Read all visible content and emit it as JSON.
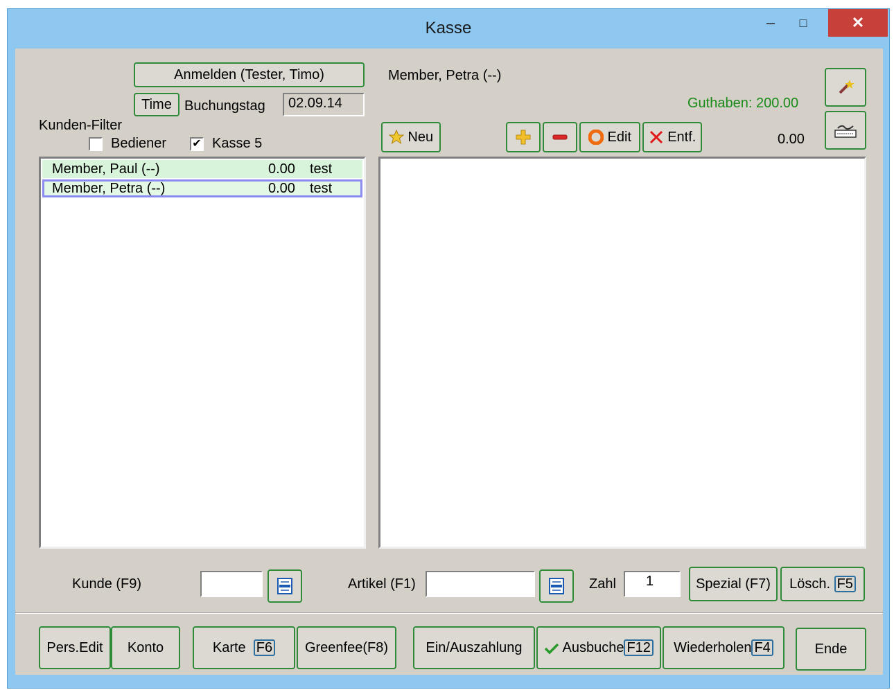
{
  "window": {
    "title": "Kasse",
    "minimize": "–",
    "maximize": "□",
    "close": "✕"
  },
  "login": {
    "button": "Anmelden (Tester, Timo)",
    "time_button": "Time",
    "buchungstag_label": "Buchungstag",
    "buchungstag_value": "02.09.14"
  },
  "filter": {
    "label": "Kunden-Filter",
    "bediener_label": "Bediener",
    "bediener_checked": false,
    "kasse_label": "Kasse 5",
    "kasse_checked": true,
    "kasse_mark": "✔"
  },
  "customers": [
    {
      "name": "Member, Paul (--)",
      "amount": "0.00",
      "note": "test"
    },
    {
      "name": "Member, Petra (--)",
      "amount": "0.00",
      "note": "test"
    }
  ],
  "selected_customer": "Member, Petra (--)",
  "guthaben": "Guthaben: 200.00",
  "total": "0.00",
  "toolbar": {
    "neu": "Neu",
    "edit": "Edit",
    "entf": "Entf."
  },
  "inputs": {
    "kunde_label": "Kunde (F9)",
    "kunde_value": "",
    "artikel_label": "Artikel (F1)",
    "artikel_value": "",
    "zahl_label": "Zahl",
    "zahl_value": "1",
    "spezial": "Spezial (F7)",
    "losch": "Lösch.",
    "losch_key": "F5"
  },
  "bottom": {
    "pers_edit": "Pers.Edit",
    "konto": "Konto",
    "karte": "Karte",
    "karte_key": "F6",
    "greenfee": "Greenfee(F8)",
    "einauszahlung": "Ein/Auszahlung",
    "ausbuchen": "Ausbuche",
    "ausbuchen_key": "F12",
    "wiederholen": "Wiederholen",
    "wiederholen_key": "F4",
    "ende": "Ende"
  },
  "colors": {
    "accent_green": "#2f8a3a",
    "guthaben": "#1a8a1a",
    "row_highlight": "#d8f5dc",
    "selection_border": "#8a8af0",
    "title_bg": "#8ec7f0",
    "close_red": "#c8403a"
  }
}
